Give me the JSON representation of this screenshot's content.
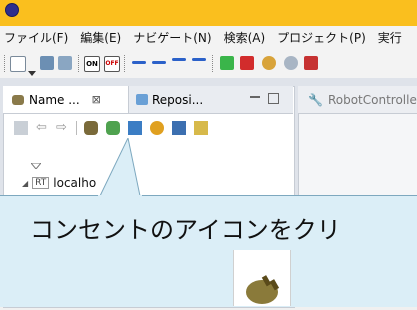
{
  "menubar": {
    "items": [
      "ファイル(F)",
      "編集(E)",
      "ナビゲート(N)",
      "検索(A)",
      "プロジェクト(P)",
      "実行"
    ]
  },
  "left_view": {
    "tab_name": "Name ...",
    "tab_repo": "Reposi...",
    "tree_root_prefix": "RT",
    "tree_root_label": "localho"
  },
  "right_view": {
    "tab_label": "RobotControlle"
  },
  "callout": {
    "text": "コンセントのアイコンをクリ"
  },
  "icons": {
    "app": "eclipse-icon",
    "connect": "plug-icon"
  }
}
